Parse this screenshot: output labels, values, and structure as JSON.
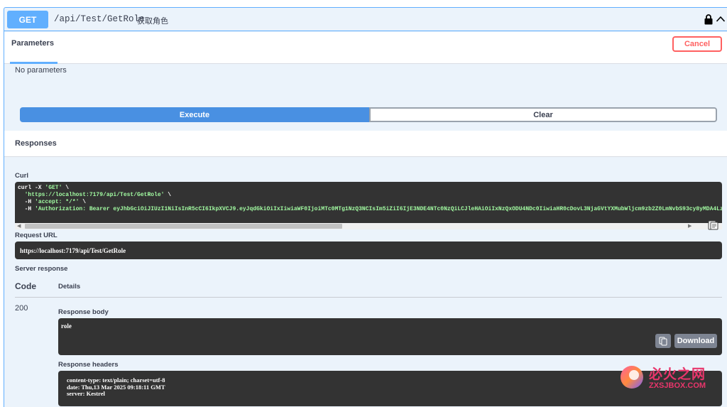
{
  "operation": {
    "method": "GET",
    "path": "/api/Test/GetRole",
    "description": "获取角色"
  },
  "tabs": {
    "parameters": "Parameters",
    "cancel": "Cancel"
  },
  "parameters": {
    "empty_text": "No parameters"
  },
  "actions": {
    "execute": "Execute",
    "clear": "Clear"
  },
  "responses": {
    "title": "Responses",
    "curl_label": "Curl",
    "curl_line1_a": "curl -X ",
    "curl_line1_b": "'GET'",
    "curl_line1_c": " \\",
    "curl_line2_a": "  ",
    "curl_line2_b": "'https://localhost:7179/api/Test/GetRole'",
    "curl_line2_c": " \\",
    "curl_line3_a": "  -H ",
    "curl_line3_b": "'accept: */*'",
    "curl_line3_c": " \\",
    "curl_line4_a": "  -H ",
    "curl_line4_b": "'Authorization: Bearer eyJhbGciOiJIUzI1NiIsInR5cCI6IkpXVCJ9.eyJqdGkiOiIxIiwiaWF0IjoiMTc0MTg1NzQ3NCIsIm5iZiI6IjE3NDE4NTc0NzQiLCJleHAiOiIxNzQxODU4NDc0IiwiaHR0cDovL3NjaGVtYXMubWljcm9zb2Z0LmNvbS93cy8yMDA4LzA",
    "request_url_label": "Request URL",
    "request_url": "https://localhost:7179/api/Test/GetRole",
    "server_response_label": "Server response",
    "code_header": "Code",
    "details_header": "Details",
    "code": "200",
    "body_label": "Response body",
    "body": "role",
    "download": "Download",
    "headers_label": "Response headers",
    "headers_line1": "content-type: text/plain; charset=utf-8",
    "headers_line2": "date: Thu,13 Mar 2025 09:18:11 GMT",
    "headers_line3": "server: Kestrel"
  },
  "watermark": {
    "cn": "必火之网",
    "en": "ZXSJBOX.COM"
  },
  "colors": {
    "get_blue": "#61affe",
    "execute_blue": "#4990e2",
    "cancel_red": "#ff6060",
    "code_bg": "#333333",
    "watermark": "#e8356b"
  },
  "icons": [
    "lock-icon",
    "chevron-up-icon",
    "copy-icon",
    "scroll-left-arrow-icon",
    "scroll-right-arrow-icon"
  ]
}
